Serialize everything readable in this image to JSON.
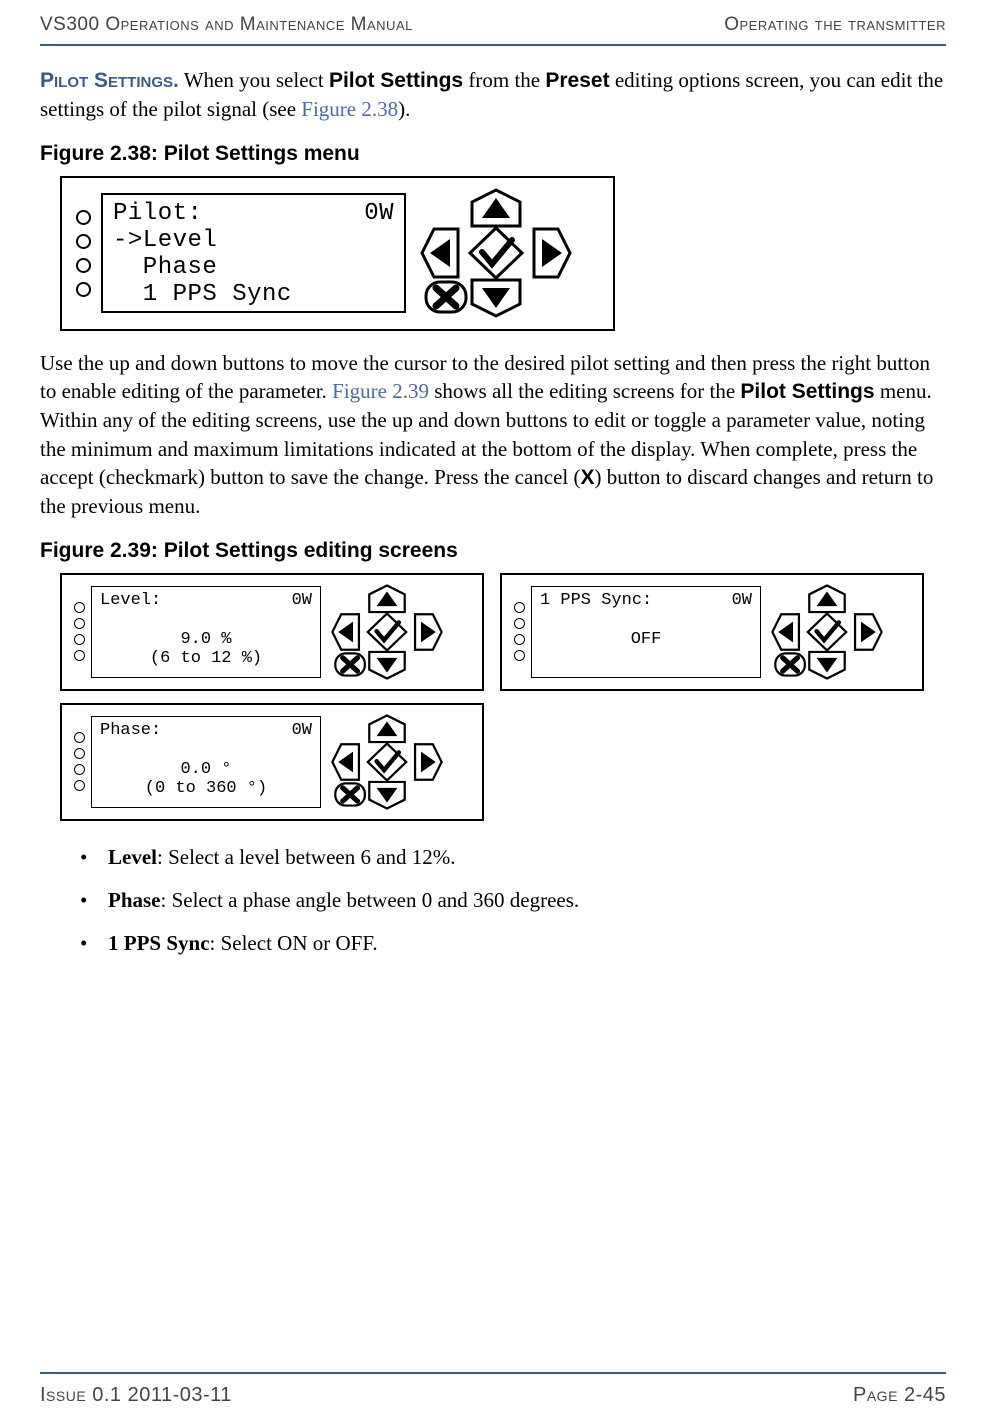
{
  "header": {
    "left": "VS300 Operations and Maintenance Manual",
    "right": "Operating the transmitter"
  },
  "footer": {
    "left": "Issue 0.1  2011-03-11",
    "right": "Page 2-45"
  },
  "pilotSettings": {
    "heading": "Pilot Settings.",
    "intro_before": " When you select ",
    "bold1": "Pilot Settings",
    "intro_mid": " from the ",
    "bold2": "Preset",
    "intro_after": " editing options screen, you can edit the settings of the pilot signal (see ",
    "xref": "Figure 2.38",
    "intro_end": ")."
  },
  "figure238": {
    "caption": "Figure 2.38: Pilot Settings menu",
    "lcd": {
      "title_left": "Pilot:",
      "title_right": "0W",
      "line2": "->Level",
      "line3": "  Phase",
      "line4": "  1 PPS Sync"
    }
  },
  "midPara": {
    "p1": "Use the up and down buttons to move the cursor to the desired pilot setting and then press the right button to enable editing of the parameter. ",
    "xref": "Figure 2.39",
    "p2": " shows all the editing screens for the ",
    "bold": "Pilot Settings",
    "p3": " menu. Within any of the editing screens, use the up and down buttons to edit or toggle a parameter value, noting the minimum and maximum limitations indicated at the bottom of the display. When complete, press the accept (checkmark) button to save the change. Press the cancel (",
    "x": "X",
    "p4": ") button to discard changes and return to the previous menu."
  },
  "figure239": {
    "caption": "Figure 2.39: Pilot Settings editing screens",
    "level": {
      "title_left": "Level:",
      "title_right": "0W",
      "value": "9.0 %",
      "range": "(6 to 12 %)"
    },
    "pps": {
      "title_left": "1 PPS Sync:",
      "title_right": "0W",
      "value": "OFF"
    },
    "phase": {
      "title_left": "Phase:",
      "title_right": "0W",
      "value": "0.0 °",
      "range": "(0 to 360 °)"
    }
  },
  "bullets": {
    "level_term": "Level",
    "level_desc": ": Select a level between 6 and 12%.",
    "phase_term": "Phase",
    "phase_desc": ": Select a phase angle between 0 and 360 degrees.",
    "pps_term": "1 PPS Sync",
    "pps_desc": ": Select ON or OFF."
  }
}
